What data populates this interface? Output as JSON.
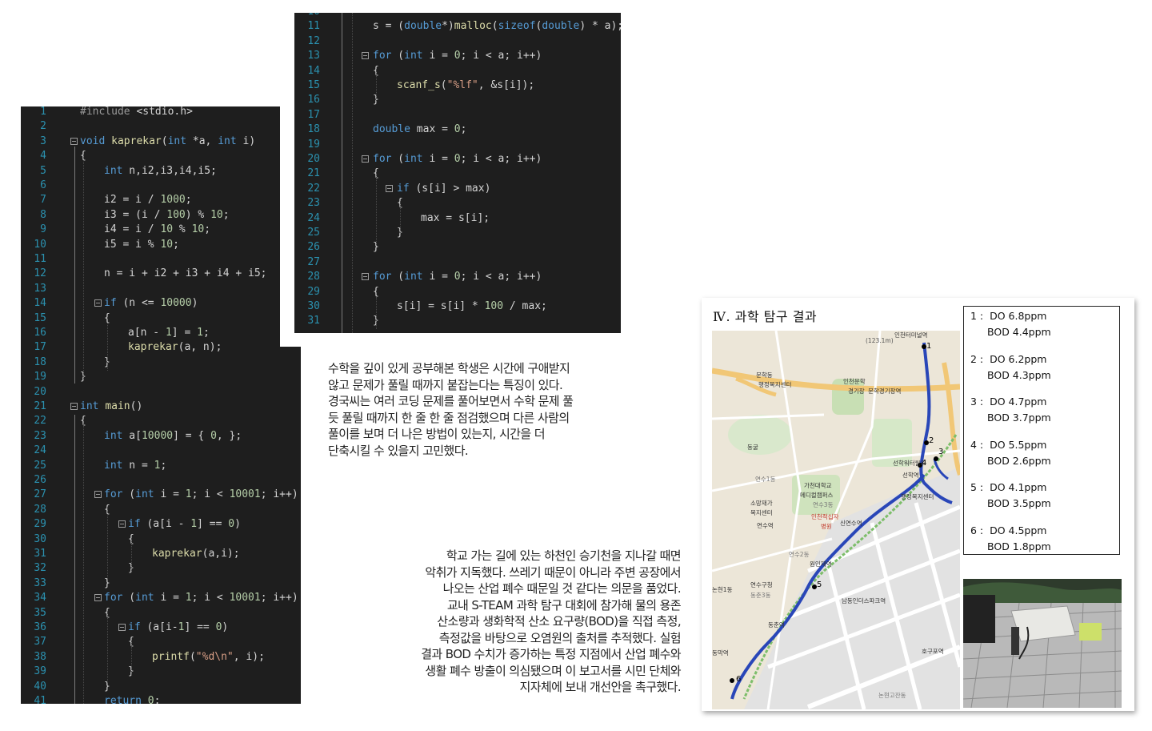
{
  "code_left": {
    "start": 1,
    "lines": [
      {
        "t": "#include <stdio.h>",
        "i": 0,
        "f": false
      },
      {
        "t": "",
        "i": 0,
        "f": false
      },
      {
        "t": "void kaprekar(int *a, int i)",
        "i": 0,
        "f": true
      },
      {
        "t": "{",
        "i": 0,
        "f": false
      },
      {
        "t": "int n,i2,i3,i4,i5;",
        "i": 1,
        "f": false
      },
      {
        "t": "",
        "i": 0,
        "f": false
      },
      {
        "t": "i2 = i / 1000;",
        "i": 1,
        "f": false
      },
      {
        "t": "i3 = (i / 100) % 10;",
        "i": 1,
        "f": false
      },
      {
        "t": "i4 = i / 10 % 10;",
        "i": 1,
        "f": false
      },
      {
        "t": "i5 = i % 10;",
        "i": 1,
        "f": false
      },
      {
        "t": "",
        "i": 0,
        "f": false
      },
      {
        "t": "n = i + i2 + i3 + i4 + i5;",
        "i": 1,
        "f": false
      },
      {
        "t": "",
        "i": 0,
        "f": false
      },
      {
        "t": "if (n <= 10000)",
        "i": 1,
        "f": true
      },
      {
        "t": "{",
        "i": 1,
        "f": false
      },
      {
        "t": "a[n - 1] = 1;",
        "i": 2,
        "f": false
      },
      {
        "t": "kaprekar(a, n);",
        "i": 2,
        "f": false
      },
      {
        "t": "}",
        "i": 1,
        "f": false
      },
      {
        "t": "}",
        "i": 0,
        "f": false
      },
      {
        "t": "",
        "i": 0,
        "f": false
      },
      {
        "t": "int main()",
        "i": 0,
        "f": true
      },
      {
        "t": "{",
        "i": 0,
        "f": false
      },
      {
        "t": "int a[10000] = { 0, };",
        "i": 1,
        "f": false
      },
      {
        "t": "",
        "i": 0,
        "f": false
      },
      {
        "t": "int n = 1;",
        "i": 1,
        "f": false
      },
      {
        "t": "",
        "i": 0,
        "f": false
      },
      {
        "t": "for (int i = 1; i < 10001; i++)",
        "i": 1,
        "f": true
      },
      {
        "t": "{",
        "i": 1,
        "f": false
      },
      {
        "t": "if (a[i - 1] == 0)",
        "i": 2,
        "f": true
      },
      {
        "t": "{",
        "i": 2,
        "f": false
      },
      {
        "t": "kaprekar(a,i);",
        "i": 3,
        "f": false
      },
      {
        "t": "}",
        "i": 2,
        "f": false
      },
      {
        "t": "}",
        "i": 1,
        "f": false
      },
      {
        "t": "for (int i = 1; i < 10001; i++)",
        "i": 1,
        "f": true
      },
      {
        "t": "{",
        "i": 1,
        "f": false
      },
      {
        "t": "if (a[i-1] == 0)",
        "i": 2,
        "f": true
      },
      {
        "t": "{",
        "i": 2,
        "f": false
      },
      {
        "t": "printf(\"%d\\n\", i);",
        "i": 3,
        "f": false
      },
      {
        "t": "}",
        "i": 2,
        "f": false
      },
      {
        "t": "}",
        "i": 1,
        "f": false
      },
      {
        "t": "return 0;",
        "i": 1,
        "f": false
      }
    ]
  },
  "code_right": {
    "start": 10,
    "lines": [
      {
        "t": "",
        "i": 0,
        "f": false
      },
      {
        "t": "s = (double*)malloc(sizeof(double) * a);",
        "i": 1,
        "f": false
      },
      {
        "t": "",
        "i": 0,
        "f": false
      },
      {
        "t": "for (int i = 0; i < a; i++)",
        "i": 1,
        "f": true
      },
      {
        "t": "{",
        "i": 1,
        "f": false
      },
      {
        "t": "scanf_s(\"%lf\", &s[i]);",
        "i": 2,
        "f": false
      },
      {
        "t": "}",
        "i": 1,
        "f": false
      },
      {
        "t": "",
        "i": 0,
        "f": false
      },
      {
        "t": "double max = 0;",
        "i": 1,
        "f": false
      },
      {
        "t": "",
        "i": 0,
        "f": false
      },
      {
        "t": "for (int i = 0; i < a; i++)",
        "i": 1,
        "f": true
      },
      {
        "t": "{",
        "i": 1,
        "f": false
      },
      {
        "t": "if (s[i] > max)",
        "i": 2,
        "f": true
      },
      {
        "t": "{",
        "i": 2,
        "f": false
      },
      {
        "t": "max = s[i];",
        "i": 3,
        "f": false
      },
      {
        "t": "}",
        "i": 2,
        "f": false
      },
      {
        "t": "}",
        "i": 1,
        "f": false
      },
      {
        "t": "",
        "i": 0,
        "f": false
      },
      {
        "t": "for (int i = 0; i < a; i++)",
        "i": 1,
        "f": true
      },
      {
        "t": "{",
        "i": 1,
        "f": false
      },
      {
        "t": "s[i] = s[i] * 100 / max;",
        "i": 2,
        "f": false
      },
      {
        "t": "}",
        "i": 1,
        "f": false
      }
    ]
  },
  "paragraph_1": [
    "수학을 깊이 있게 공부해본 학생은 시간에 구애받지",
    "않고 문제가 풀릴 때까지 붙잡는다는 특징이 있다.",
    "경국씨는 여러 코딩 문제를 풀어보면서 수학 문제 풀",
    "듯 풀릴 때까지 한 줄 한 줄 점검했으며 다른 사람의",
    "풀이를 보며 더 나은 방법이 있는지, 시간을 더",
    "단축시킬 수 있을지 고민했다."
  ],
  "paragraph_2": [
    "학교 가는 길에 있는 하천인 승기천을 지나갈 때면",
    "악취가 지독했다. 쓰레기 때문이 아니라 주변 공장에서",
    "나오는 산업 폐수 때문일 것 같다는 의문을 품었다.",
    "교내 S-TEAM 과학 탐구 대회에 참가해 물의 용존",
    "산소량과 생화학적 산소 요구량(BOD)을 직접 측정,",
    "측정값을 바탕으로 오염원의 출처를 추적했다. 실험",
    "결과 BOD 수치가 증가하는 특정 지점에서 산업 폐수와",
    "생활 폐수 방출이 의심됐으며 이 보고서를 시민 단체와",
    "지자체에 보내 개선안을 촉구했다."
  ],
  "report": {
    "title": "Ⅳ. 과학  탐구  결과",
    "results": [
      {
        "num": "1",
        "do": "DO 6.8ppm",
        "bod": "BOD 4.4ppm"
      },
      {
        "num": "2",
        "do": "DO 6.2ppm",
        "bod": "BOD 4.3ppm"
      },
      {
        "num": "3",
        "do": "DO 4.7ppm",
        "bod": "BOD 3.7ppm"
      },
      {
        "num": "4",
        "do": "DO 5.5ppm",
        "bod": "BOD 2.6ppm"
      },
      {
        "num": "5",
        "do": "DO 4.1ppm",
        "bod": "BOD 3.5ppm"
      },
      {
        "num": "6",
        "do": "DO 4.5ppm",
        "bod": "BOD 1.8ppm"
      }
    ],
    "map": {
      "labels": [
        {
          "t": "인천터미널역"
        },
        {
          "t": "(123.1m)"
        },
        {
          "t": "문학동"
        },
        {
          "t": "행정복지센터"
        },
        {
          "t": "인천문학"
        },
        {
          "t": "경기장"
        },
        {
          "t": "문학경기장역"
        },
        {
          "t": "동굴"
        },
        {
          "t": "선학워터월드"
        },
        {
          "t": "선학역"
        },
        {
          "t": "연수1동"
        },
        {
          "t": "가천대학교"
        },
        {
          "t": "메디컬캠퍼스"
        },
        {
          "t": "연수3동"
        },
        {
          "t": "소망재가"
        },
        {
          "t": "복지센터"
        },
        {
          "t": "인천적십자"
        },
        {
          "t": "병원"
        },
        {
          "t": "신연수역"
        },
        {
          "t": "연수역"
        },
        {
          "t": "연수2동"
        },
        {
          "t": "원인재역"
        },
        {
          "t": "연수구청"
        },
        {
          "t": "동춘3동"
        },
        {
          "t": "남동인더스파크역"
        },
        {
          "t": "논현1동"
        },
        {
          "t": "동춘역"
        },
        {
          "t": "호구포역"
        },
        {
          "t": "논현고잔동"
        },
        {
          "t": "동막역"
        },
        {
          "t": "행정복지센터"
        }
      ],
      "station_labels": [
        "1",
        "2",
        "3",
        "4",
        "5",
        "6"
      ]
    }
  }
}
